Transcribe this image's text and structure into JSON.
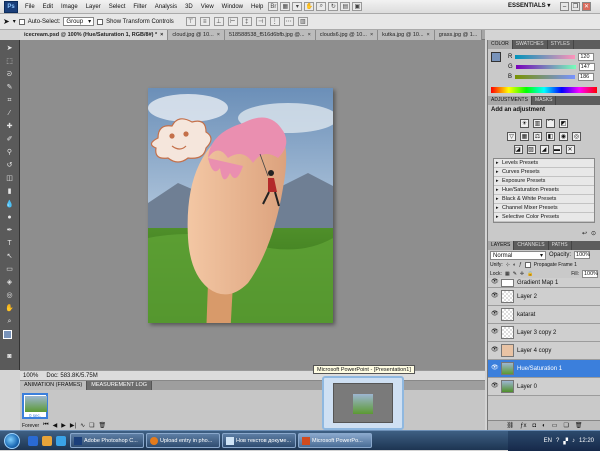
{
  "app": {
    "logo": "Ps",
    "essentials": "ESSENTIALS ▾"
  },
  "menu": [
    "File",
    "Edit",
    "Image",
    "Layer",
    "Select",
    "Filter",
    "Analysis",
    "3D",
    "View",
    "Window",
    "Help"
  ],
  "options": {
    "auto_select_label": "Auto-Select:",
    "auto_select_value": "Group",
    "transform_label": "Show Transform Controls"
  },
  "doc_tabs": [
    {
      "label": "icecream.psd @ 100% (Hue/Saturation 1, RGB/8#) *",
      "active": true
    },
    {
      "label": "cloud.jpg @ 10...",
      "active": false
    },
    {
      "label": "518588538_f516d6bfb.jpg @...",
      "active": false
    },
    {
      "label": "clouds6.jpg @ 10...",
      "active": false
    },
    {
      "label": "kutka.jpg @ 10...",
      "active": false
    },
    {
      "label": "grass.jpg @ 1...",
      "active": false
    }
  ],
  "status": {
    "zoom": "100%",
    "doc": "Doc: 583.8K/5.75M"
  },
  "anim": {
    "tabs": [
      "ANIMATION (FRAMES)",
      "MEASUREMENT LOG"
    ],
    "frame_time": "0 sec.",
    "loop": "Forever"
  },
  "color_panel": {
    "tabs": [
      "COLOR",
      "SWATCHES",
      "STYLES"
    ],
    "r": "120",
    "g": "147",
    "b": "186",
    "fg_color": "#7893ba"
  },
  "adjustments": {
    "tabs": [
      "ADJUSTMENTS",
      "MASKS"
    ],
    "heading": "Add an adjustment",
    "presets": [
      "Levels Presets",
      "Curves Presets",
      "Exposure Presets",
      "Hue/Saturation Presets",
      "Black & White Presets",
      "Channel Mixer Presets",
      "Selective Color Presets"
    ]
  },
  "layers_panel": {
    "tabs": [
      "LAYERS",
      "CHANNELS",
      "PATHS"
    ],
    "blend": "Normal",
    "opacity_label": "Opacity:",
    "opacity": "100%",
    "unify_label": "Unify:",
    "propagate": "Propagate Frame 1",
    "lock_label": "Lock:",
    "fill_label": "Fill:",
    "fill": "100%",
    "layers": [
      {
        "name": "Gradient Map 1",
        "selected": false
      },
      {
        "name": "Layer 2",
        "selected": false
      },
      {
        "name": "katarat",
        "selected": false
      },
      {
        "name": "Layer 3 copy 2",
        "selected": false
      },
      {
        "name": "Layer 4 copy",
        "selected": false
      },
      {
        "name": "Hue/Saturation 1",
        "selected": true
      },
      {
        "name": "Layer 0",
        "selected": false
      }
    ]
  },
  "tooltip": "Microsoft PowerPoint - [Presentation1]",
  "taskbar": {
    "tasks": [
      {
        "label": "Adobe Photoshop C...",
        "active": false
      },
      {
        "label": "Upload entry in pho...",
        "active": false
      },
      {
        "label": "Нов текстов докуме...",
        "active": false
      },
      {
        "label": "Microsoft PowerPo...",
        "active": true
      }
    ],
    "lang": "EN",
    "time": "12:20"
  }
}
